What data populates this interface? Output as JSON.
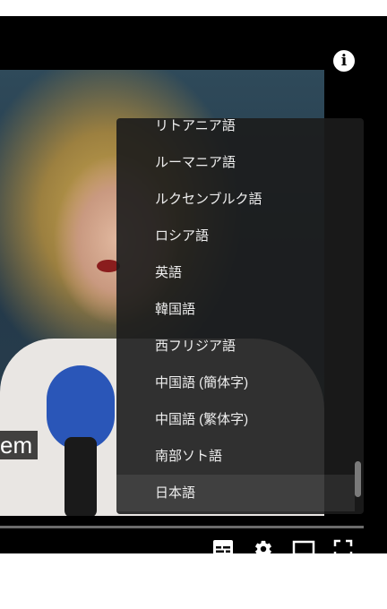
{
  "overlay": {
    "caption_text": "em"
  },
  "info_button": {
    "glyph": "i"
  },
  "subtitle_menu": {
    "items": [
      {
        "label": "リトアニア語"
      },
      {
        "label": "ルーマニア語"
      },
      {
        "label": "ルクセンブルク語"
      },
      {
        "label": "ロシア語"
      },
      {
        "label": "英語"
      },
      {
        "label": "韓国語"
      },
      {
        "label": "西フリジア語"
      },
      {
        "label": "中国語 (簡体字)"
      },
      {
        "label": "中国語 (繁体字)"
      },
      {
        "label": "南部ソト語"
      },
      {
        "label": "日本語"
      }
    ],
    "selected_label": "日本語"
  },
  "controls": {
    "subtitles_icon": "subtitles-icon",
    "settings_icon": "gear-icon",
    "theater_icon": "theater-mode-icon",
    "fullscreen_icon": "fullscreen-icon",
    "subtitles_active_color": "#ff0000"
  }
}
